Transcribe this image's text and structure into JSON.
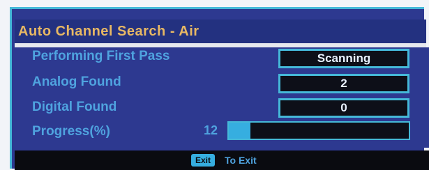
{
  "dialog": {
    "title": "Auto Channel Search - Air"
  },
  "rows": {
    "pass": {
      "label": "Performing First Pass",
      "value": "Scanning"
    },
    "analog": {
      "label": "Analog  Found",
      "value": "2"
    },
    "digital": {
      "label": "Digital  Found",
      "value": "0"
    },
    "progress": {
      "label": "Progress(%)",
      "value": "12",
      "fraction": 0.12
    }
  },
  "footer": {
    "key_label": "Exit",
    "hint": "To Exit"
  },
  "colors": {
    "panel_bg": "#2d3990",
    "title_text": "#e7b864",
    "label_text": "#4fa3df",
    "accent_border": "#45b8d8",
    "box_bg": "#0d0f18"
  }
}
